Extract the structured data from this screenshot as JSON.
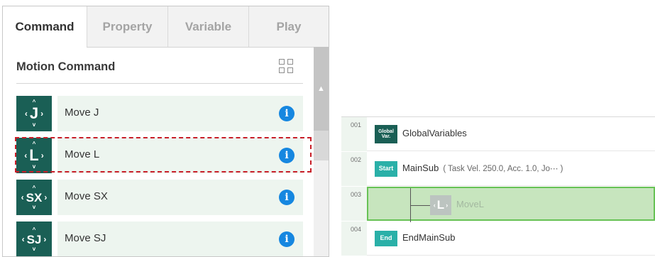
{
  "tabs": [
    {
      "label": "Command",
      "active": true
    },
    {
      "label": "Property",
      "active": false
    },
    {
      "label": "Variable",
      "active": false
    },
    {
      "label": "Play",
      "active": false
    }
  ],
  "section": {
    "title": "Motion Command",
    "view_icon": "grid-view-icon"
  },
  "commands": [
    {
      "label": "Move J",
      "icon_letter": "J",
      "info_icon": "info-icon"
    },
    {
      "label": "Move L",
      "icon_letter": "L",
      "info_icon": "info-icon"
    },
    {
      "label": "Move SX",
      "icon_letter": "SX",
      "info_icon": "info-icon"
    },
    {
      "label": "Move SJ",
      "icon_letter": "SJ",
      "info_icon": "info-icon"
    }
  ],
  "highlighted_command": "Move L",
  "script": {
    "lines": [
      {
        "num": "001",
        "icon": "Global Var.",
        "text": "GlobalVariables",
        "detail": ""
      },
      {
        "num": "002",
        "icon": "Start",
        "text": "MainSub",
        "detail": "( Task Vel. 250.0, Acc. 1.0, Jo⋯ )"
      },
      {
        "num": "003",
        "icon": "L",
        "text": "MoveL",
        "detail": ""
      },
      {
        "num": "004",
        "icon": "End",
        "text": "EndMainSub",
        "detail": ""
      }
    ]
  },
  "colors": {
    "command_icon_bg": "#1a5f55",
    "command_row_bg": "#edf5ef",
    "info_blue": "#1687e0",
    "highlight_dashed": "#c81e28",
    "selected_row_bg": "#c7e5be",
    "selected_row_border": "#67c255",
    "script_icon_teal": "#2ab0a8"
  }
}
